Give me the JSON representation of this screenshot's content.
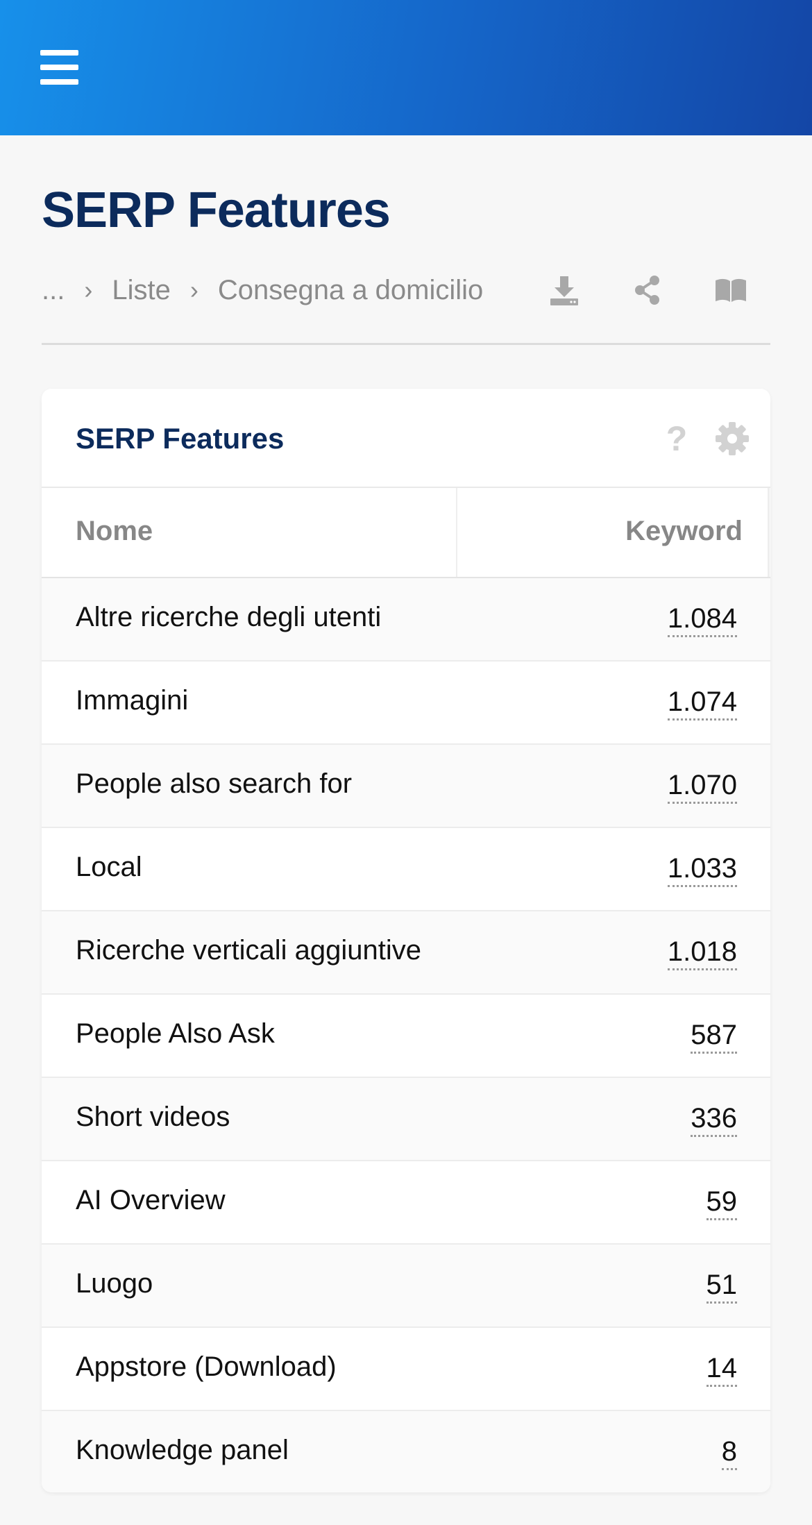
{
  "header": {
    "menu_icon": "hamburger-menu-icon",
    "accent_gradient": [
      "#1790ea",
      "#1446a6"
    ]
  },
  "page": {
    "title": "SERP Features"
  },
  "breadcrumb": {
    "items": [
      "...",
      "Liste",
      "Consegna a domicilio"
    ],
    "separator_icon": "chevron-right-icon",
    "actions": [
      "download-icon",
      "share-icon",
      "book-icon"
    ]
  },
  "card": {
    "title": "SERP Features",
    "help_icon": "?",
    "settings_icon": "gear-icon",
    "columns": {
      "name": "Nome",
      "keyword": "Keyword"
    },
    "rows": [
      {
        "name": "Altre ricerche degli utenti",
        "value": "1.084"
      },
      {
        "name": "Immagini",
        "value": "1.074"
      },
      {
        "name": "People also search for",
        "value": "1.070"
      },
      {
        "name": "Local",
        "value": "1.033"
      },
      {
        "name": "Ricerche verticali aggiuntive",
        "value": "1.018"
      },
      {
        "name": "People Also Ask",
        "value": "587"
      },
      {
        "name": "Short videos",
        "value": "336"
      },
      {
        "name": "AI Overview",
        "value": "59"
      },
      {
        "name": "Luogo",
        "value": "51"
      },
      {
        "name": "Appstore (Download)",
        "value": "14"
      },
      {
        "name": "Knowledge panel",
        "value": "8"
      }
    ]
  },
  "colors": {
    "title": "#0c2b5c",
    "muted": "#8a8a8a",
    "background": "#f7f7f7"
  }
}
